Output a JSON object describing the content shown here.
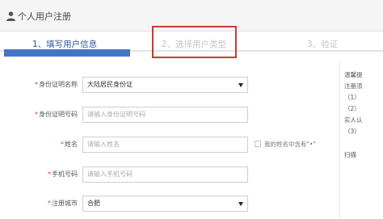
{
  "header": {
    "title": "个人用户注册"
  },
  "steps": [
    {
      "label": "1、填写用户信息"
    },
    {
      "label": "2、选择用户类型"
    },
    {
      "label": "3、验证"
    }
  ],
  "form": {
    "id_type": {
      "label": "身份证明名称",
      "value": "大陆居民身份证"
    },
    "id_number": {
      "label": "身份证明号码",
      "placeholder": "请输入身份证明号码"
    },
    "name": {
      "label": "姓名",
      "placeholder": "请输入姓名",
      "checkbox_label": "我的姓名中含有\"•\""
    },
    "phone": {
      "label": "手机号码",
      "placeholder": "请输入手机号码"
    },
    "city": {
      "label": "注册城市",
      "value": "合肥"
    }
  },
  "sidebar": {
    "lines": [
      "温馨提",
      "注册须",
      "（1）",
      "（2）",
      "实人认",
      "（3）",
      "扫描"
    ]
  }
}
